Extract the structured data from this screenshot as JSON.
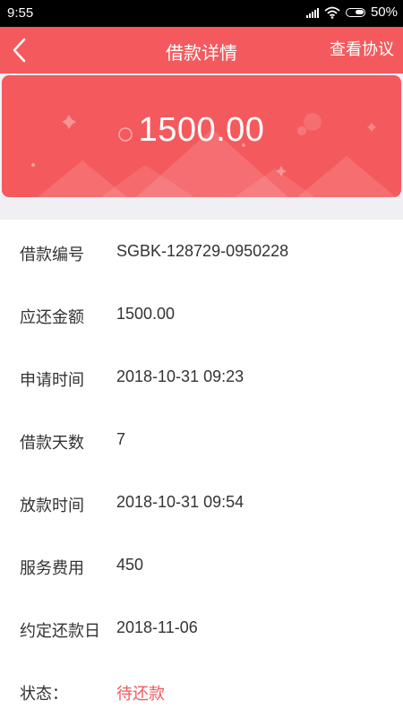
{
  "status_bar": {
    "time": "9:55",
    "battery": "50%"
  },
  "header": {
    "title": "借款详情",
    "action_label": "查看协议",
    "background_color": "#f45a5d"
  },
  "card": {
    "amount": "1500.00"
  },
  "details": [
    {
      "label": "借款编号",
      "value": "SGBK-128729-0950228"
    },
    {
      "label": "应还金额",
      "value": "1500.00"
    },
    {
      "label": "申请时间",
      "value": "2018-10-31 09:23"
    },
    {
      "label": "借款天数",
      "value": "7"
    },
    {
      "label": "放款时间",
      "value": "2018-10-31 09:54"
    },
    {
      "label": "服务费用",
      "value": "450"
    },
    {
      "label": "约定还款日",
      "value": "2018-11-06"
    },
    {
      "label": "状态：",
      "value": "待还款"
    }
  ],
  "colors": {
    "accent": "#f45a5d",
    "text": "#333333",
    "band": "#f0f0f4"
  }
}
